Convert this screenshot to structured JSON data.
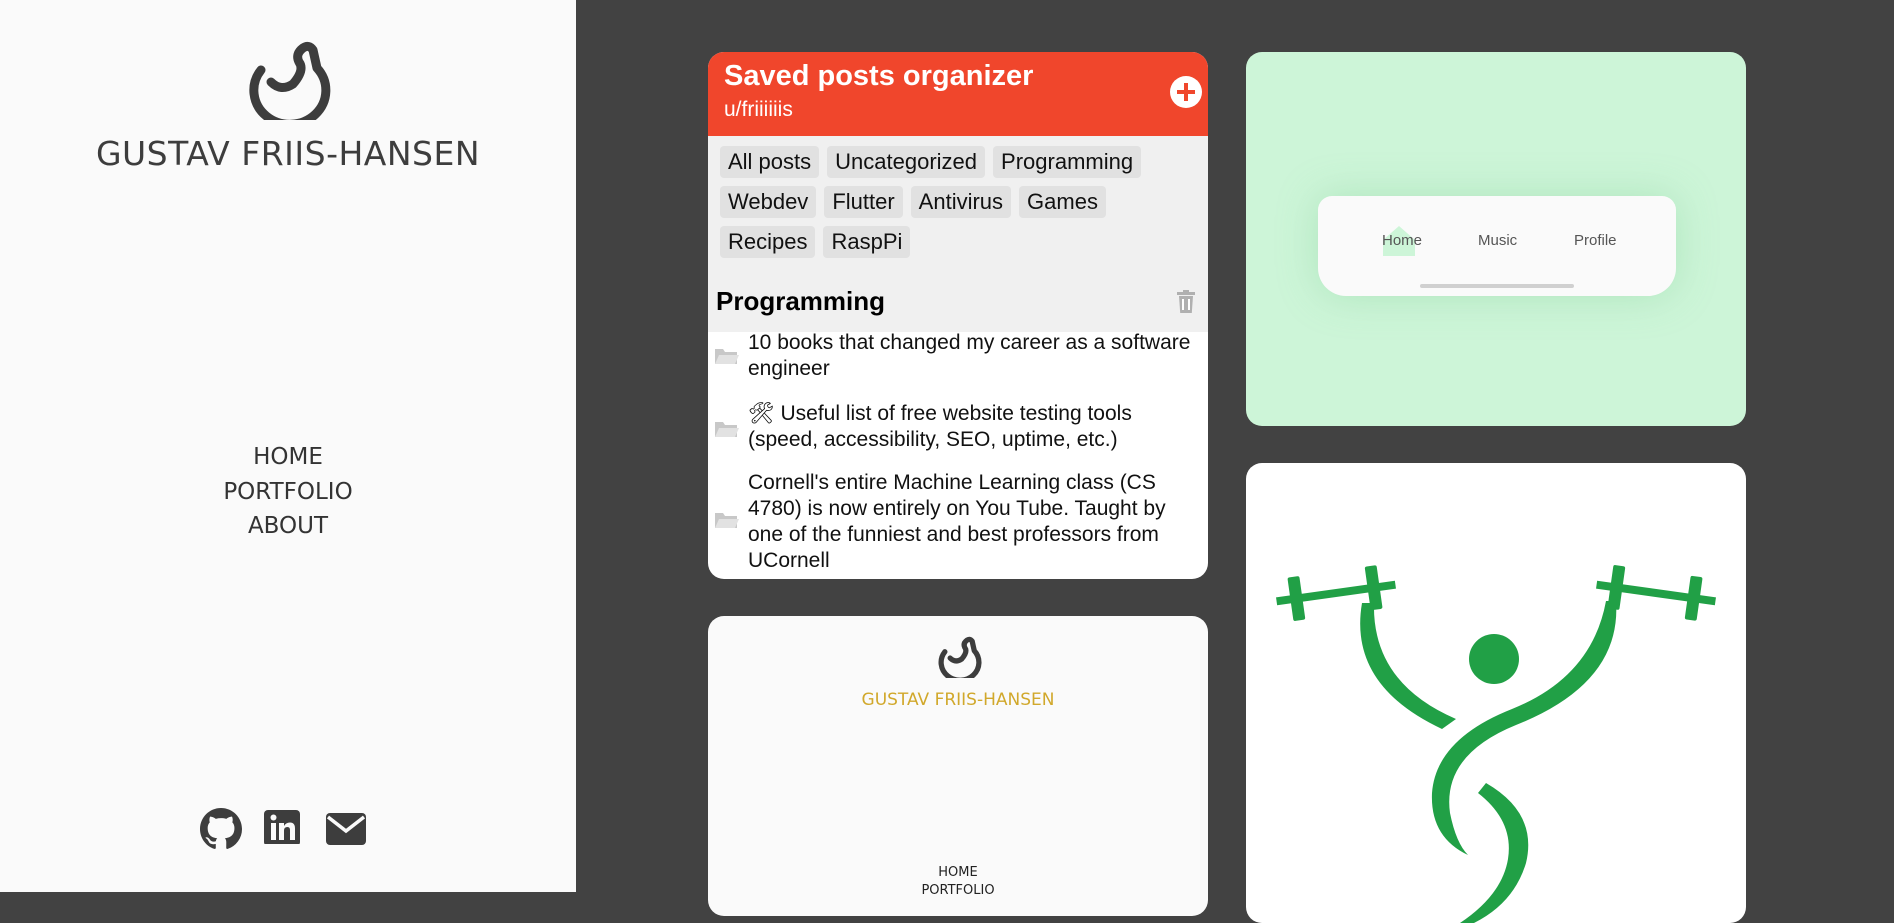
{
  "sidebar": {
    "logo_icon": "g-swirl-logo-icon",
    "name": "GUSTAV FRIIS-HANSEN",
    "nav": [
      "HOME",
      "PORTFOLIO",
      "ABOUT"
    ],
    "social": [
      {
        "icon": "github-icon"
      },
      {
        "icon": "linkedin-icon"
      },
      {
        "icon": "email-icon"
      }
    ]
  },
  "saved_posts_card": {
    "title": "Saved posts organizer",
    "user": "u/friiiiiis",
    "accent": "#f0462c",
    "tags": [
      "All posts",
      "Uncategorized",
      "Programming",
      "Webdev",
      "Flutter",
      "Antivirus",
      "Games",
      "Recipes",
      "RaspPi"
    ],
    "section_title": "Programming",
    "posts": [
      "10 books that changed my career as a software engineer",
      "🛠 Useful list of free website testing tools (speed, accessibility, SEO, uptime, etc.)",
      "Cornell's entire Machine Learning class (CS 4780) is now entirely on You Tube. Taught by one of the funniest and best professors from UCornell"
    ]
  },
  "nav_mockup_card": {
    "background": "#cdf5d8",
    "items": [
      "Home",
      "Music",
      "Profile"
    ]
  },
  "website_card": {
    "name": "GUSTAV FRIIS-HANSEN",
    "name_color": "#d1a82b",
    "nav": [
      "HOME",
      "PORTFOLIO"
    ]
  },
  "fitness_card": {
    "logo_icon": "weightlifter-logo-icon",
    "color": "#21a046"
  }
}
